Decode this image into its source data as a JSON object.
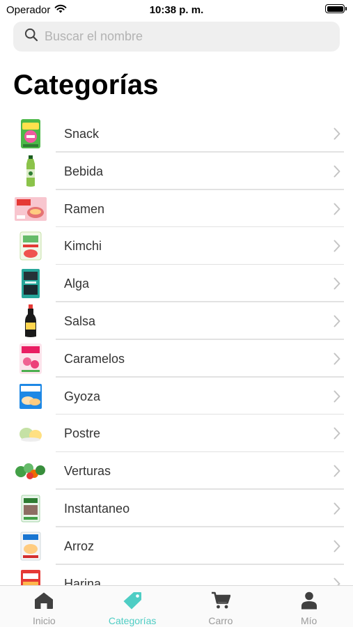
{
  "status_bar": {
    "carrier": "Operador",
    "time": "10:38 p. m."
  },
  "search": {
    "placeholder": "Buscar el nombre"
  },
  "page_title": "Categorías",
  "categories": [
    {
      "label": "Snack",
      "icon": "snack-package-thumbnail"
    },
    {
      "label": "Bebida",
      "icon": "drink-bottle-thumbnail"
    },
    {
      "label": "Ramen",
      "icon": "ramen-package-thumbnail"
    },
    {
      "label": "Kimchi",
      "icon": "kimchi-package-thumbnail"
    },
    {
      "label": "Alga",
      "icon": "seaweed-package-thumbnail"
    },
    {
      "label": "Salsa",
      "icon": "sauce-bottle-thumbnail"
    },
    {
      "label": "Caramelos",
      "icon": "candy-package-thumbnail"
    },
    {
      "label": "Gyoza",
      "icon": "gyoza-package-thumbnail"
    },
    {
      "label": "Postre",
      "icon": "dessert-mochi-thumbnail"
    },
    {
      "label": "Verturas",
      "icon": "vegetables-thumbnail"
    },
    {
      "label": "Instantaneo",
      "icon": "instant-food-thumbnail"
    },
    {
      "label": "Arroz",
      "icon": "rice-package-thumbnail"
    },
    {
      "label": "Harina",
      "icon": "flour-package-thumbnail"
    }
  ],
  "tabbar": {
    "tabs": [
      {
        "label": "Inicio",
        "icon": "home-icon",
        "active": false
      },
      {
        "label": "Categorías",
        "icon": "tag-icon",
        "active": true
      },
      {
        "label": "Carro",
        "icon": "cart-icon",
        "active": false
      },
      {
        "label": "Mío",
        "icon": "person-icon",
        "active": false
      }
    ]
  },
  "colors": {
    "accent": "#4ecdc4",
    "inactive_tab": "#9a9a9a",
    "search_bg": "#efefef"
  }
}
